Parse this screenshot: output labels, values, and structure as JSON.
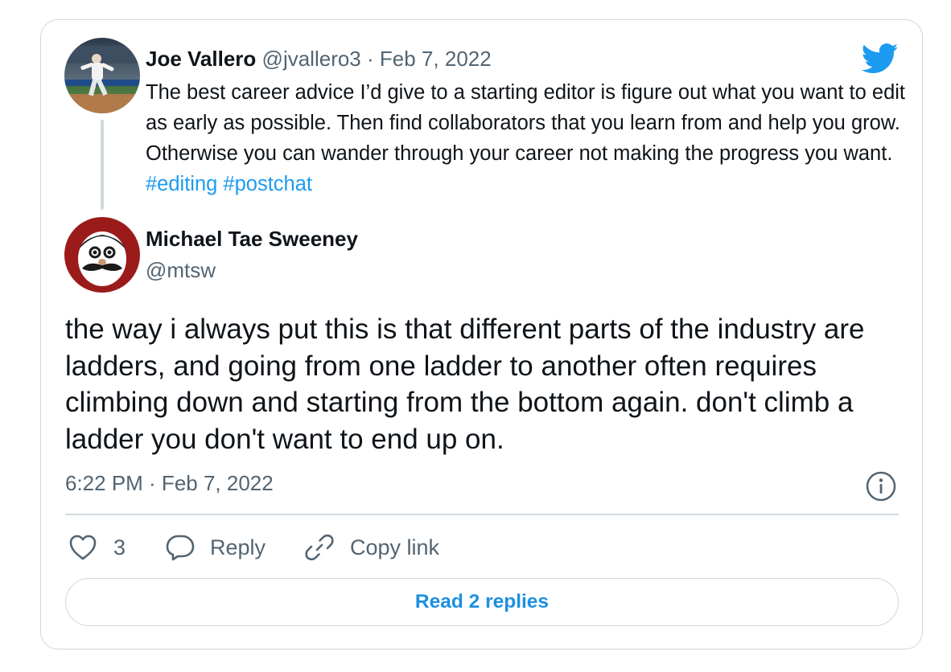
{
  "parent_tweet": {
    "author_name": "Joe Vallero",
    "handle": "@jvallero3",
    "separator": "·",
    "date": "Feb 7, 2022",
    "text": "The best career advice I’d give to a starting editor is figure out what you want to edit as early as possible. Then find collaborators that you learn from and help you grow. Otherwise you can wander through your career not making the progress you want.",
    "hashtags": [
      "#editing",
      "#postchat"
    ],
    "avatar_icon": "baseball-pitcher-avatar"
  },
  "main_tweet": {
    "author_name": "Michael Tae Sweeney",
    "handle": "@mtsw",
    "avatar_icon": "mustache-mascot-avatar",
    "text": "the way i always put this is that different parts of the industry are ladders, and going from one ladder to another often requires climbing down and starting from the bottom again. don't climb a ladder you don't want to end up on.",
    "timestamp": "6:22 PM · Feb 7, 2022"
  },
  "actions": {
    "like_count": "3",
    "reply_label": "Reply",
    "copy_link_label": "Copy link"
  },
  "read_replies_label": "Read 2 replies",
  "icons": {
    "brand": "twitter-bird-icon",
    "info": "info-icon",
    "like": "heart-icon",
    "reply": "speech-bubble-icon",
    "copy": "link-icon"
  },
  "colors": {
    "brand_blue": "#1d9bf0",
    "text": "#0f1419",
    "muted": "#536471",
    "border": "#cfd9de",
    "avatar_red": "#9b1b1b"
  }
}
